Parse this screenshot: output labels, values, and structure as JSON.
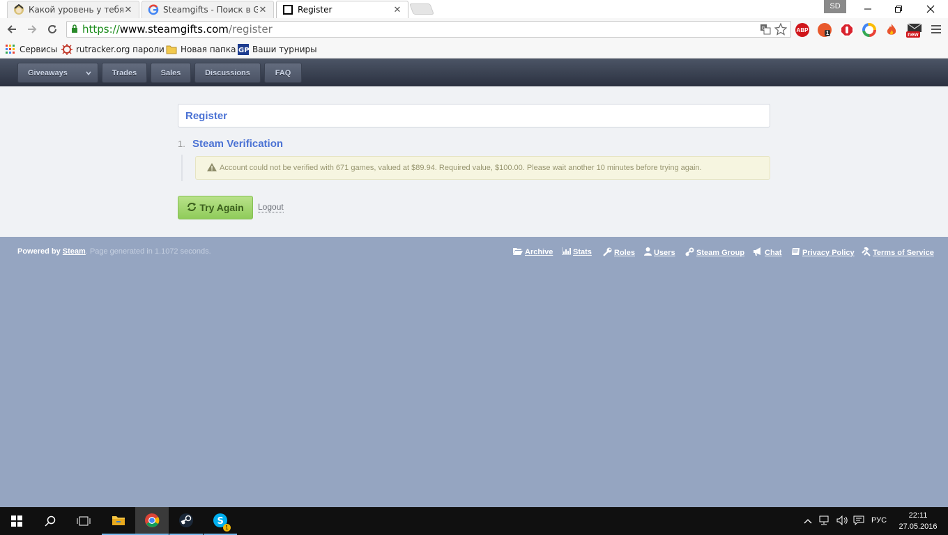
{
  "browser": {
    "tabs": [
      {
        "title": "Какой уровень у тебя на",
        "icon": "anime-avatar-icon",
        "active": false
      },
      {
        "title": "Steamgifts - Поиск в Goo",
        "icon": "google-icon",
        "active": false
      },
      {
        "title": "Register",
        "icon": "steamgifts-icon",
        "active": true
      }
    ],
    "profile_label": "SD",
    "url": {
      "scheme": "https://",
      "host": "www.steamgifts.com",
      "path": "/register"
    },
    "extensions": {
      "abp": "ABP",
      "badge_count": "1",
      "new_label": "new"
    },
    "bookmarks": [
      {
        "label": "Сервисы",
        "icon": "apps-grid-icon"
      },
      {
        "label": "rutracker.org пароли",
        "icon": "rutracker-icon"
      },
      {
        "label": "Новая папка",
        "icon": "folder-icon"
      },
      {
        "label": "Ваши турниры",
        "icon": "gp-icon"
      }
    ]
  },
  "site": {
    "nav": [
      "Giveaways",
      "Trades",
      "Sales",
      "Discussions",
      "FAQ"
    ],
    "page_heading": "Register",
    "step": {
      "number": "1.",
      "title": "Steam Verification"
    },
    "warning": "Account could not be verified with 671 games, valued at $89.94. Required value, $100.00. Please wait another 10 minutes before trying again.",
    "try_again": "Try Again",
    "logout": "Logout",
    "footer": {
      "powered_prefix": "Powered by ",
      "powered_link": "Steam",
      "generated": ". Page generated in 1.1072 seconds.",
      "links": [
        "Archive",
        "Stats",
        "Roles",
        "Users",
        "Steam Group",
        "Chat",
        "Privacy Policy",
        "Terms of Service"
      ]
    }
  },
  "taskbar": {
    "lang": "РУС",
    "time": "22:11",
    "date": "27.05.2016",
    "skype_badge": "1"
  },
  "colors": {
    "accent_blue": "#4b72d4",
    "nav_dark": "#2b3140",
    "footer_bg": "#95a5c1",
    "button_green": "#8fcb5a",
    "warning_bg": "#f6f5e0"
  }
}
